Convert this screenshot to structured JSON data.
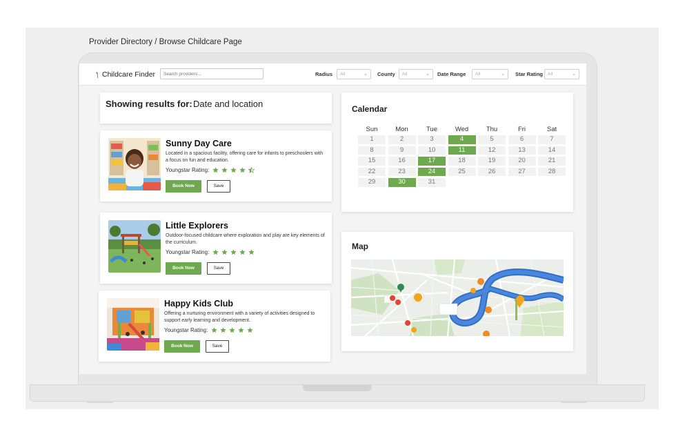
{
  "page_caption": "Provider Directory / Browse Childcare Page",
  "header": {
    "brand": "Childcare Finder",
    "search_placeholder": "Search providers...",
    "filters": [
      {
        "label": "Radius",
        "value": "All"
      },
      {
        "label": "County",
        "value": "All"
      },
      {
        "label": "Date Range",
        "value": "All"
      },
      {
        "label": "Star Rating",
        "value": "All"
      }
    ]
  },
  "results": {
    "label": "Showing results for:",
    "value": "Date and location"
  },
  "providers": [
    {
      "name": "Sunny Day Care",
      "description": "Located in a spacious facility, offering care for infants to preschoolers with a focus on fun and education.",
      "rating_label": "Youngstar Rating:",
      "rating": 4.5,
      "book_label": "Book Now",
      "save_label": "Save"
    },
    {
      "name": "Little Explorers",
      "description": "Outdoor-focused childcare where exploration and play are key elements of the curriculum.",
      "rating_label": "Youngstar Rating:",
      "rating": 5,
      "book_label": "Book Now",
      "save_label": "Save"
    },
    {
      "name": "Happy Kids Club",
      "description": "Offering a nurturing environment with a variety of activities designed to support early learning and development.",
      "rating_label": "Youngstar Rating:",
      "rating": 5,
      "book_label": "Book Now",
      "save_label": "Save"
    }
  ],
  "calendar": {
    "title": "Calendar",
    "weekdays": [
      "Sun",
      "Mon",
      "Tue",
      "Wed",
      "Thu",
      "Fri",
      "Sat"
    ],
    "weeks": [
      [
        "1",
        "2",
        "3",
        "4",
        "5",
        "6",
        "7"
      ],
      [
        "8",
        "9",
        "10",
        "11",
        "12",
        "13",
        "14"
      ],
      [
        "15",
        "16",
        "17",
        "18",
        "19",
        "20",
        "21"
      ],
      [
        "22",
        "23",
        "24",
        "25",
        "26",
        "27",
        "28"
      ],
      [
        "29",
        "30",
        "31",
        "",
        "",
        "",
        ""
      ]
    ],
    "selected": [
      "4",
      "11",
      "17",
      "24",
      "30"
    ]
  },
  "map": {
    "title": "Map"
  },
  "colors": {
    "accent": "#6ea84f",
    "star": "#6ea84f",
    "river": "#2f6fc9"
  }
}
